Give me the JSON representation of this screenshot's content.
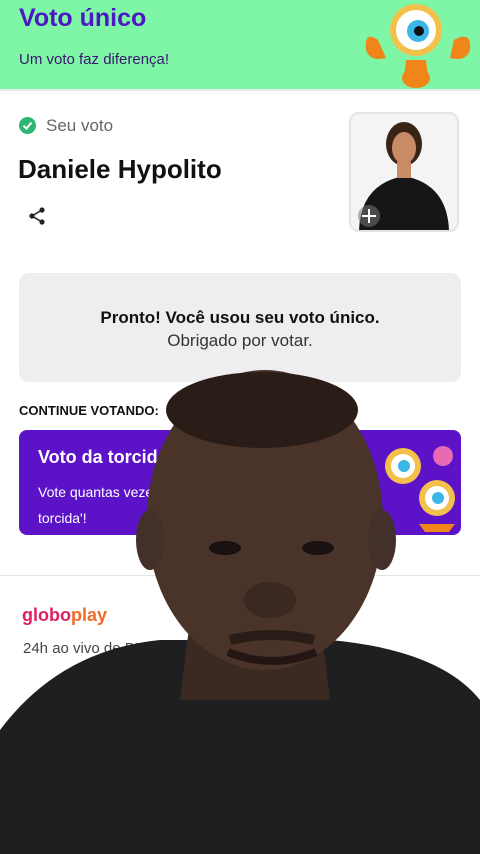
{
  "banner": {
    "title": "Voto único",
    "subtitle": "Um voto faz diferença!",
    "bg_color": "#7ff5a6",
    "title_color": "#4b18c4"
  },
  "vote": {
    "status_label": "Seu voto",
    "status_icon": "check-circle-icon",
    "candidate": "Daniele Hypolito",
    "share_icon": "share-icon"
  },
  "confirmation": {
    "title": "Pronto! Você usou seu voto único.",
    "subtitle": "Obrigado por votar."
  },
  "continue_section": {
    "heading": "CONTINUE VOTANDO:",
    "card": {
      "title": "Voto da torcida",
      "description": "Vote quantas vezes quiser no 'Voto da torcida'!",
      "bg_color": "#5c12c7"
    }
  },
  "promo": {
    "brand_glo": "globo",
    "brand_play": "play",
    "description": "24h ao vivo de BBB é só no Globoplay"
  }
}
